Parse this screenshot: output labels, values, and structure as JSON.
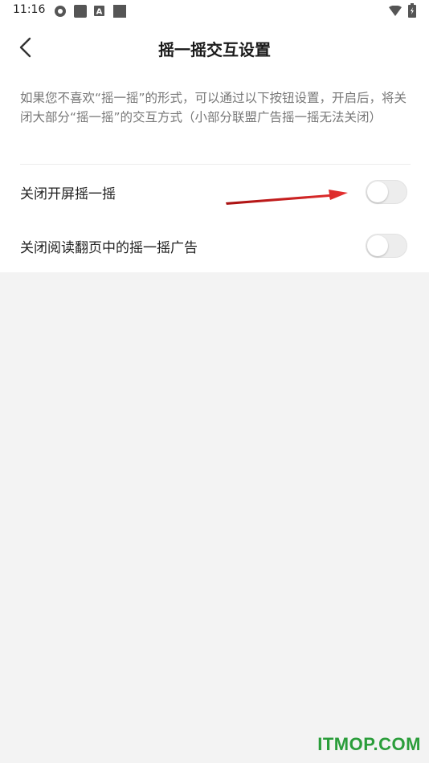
{
  "status_bar": {
    "time": "11:16"
  },
  "header": {
    "title": "摇一摇交互设置"
  },
  "description": "如果您不喜欢“摇一摇”的形式，可以通过以下按钮设置，开启后，将关闭大部分“摇一摇”的交互方式（小部分联盟广告摇一摇无法关闭）",
  "settings": [
    {
      "label": "关闭开屏摇一摇",
      "enabled": false
    },
    {
      "label": "关闭阅读翻页中的摇一摇广告",
      "enabled": false
    }
  ],
  "watermark": "ITMOP.COM",
  "colors": {
    "arrow": "#d42020",
    "watermark": "#2a9d3a",
    "toggle_off": "#ededed"
  }
}
